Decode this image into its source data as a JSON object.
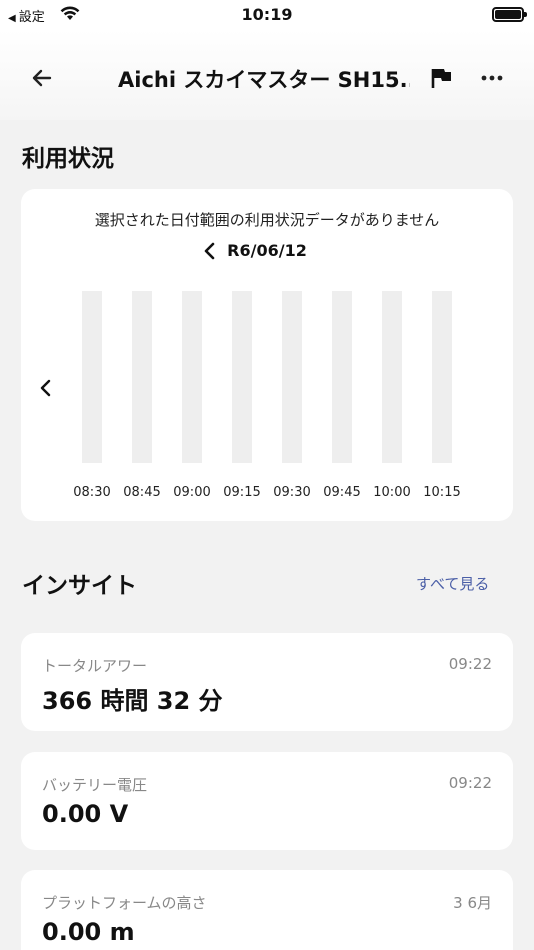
{
  "status_bar": {
    "back_label": "設定",
    "time": "10:19"
  },
  "nav": {
    "title": "Aichi スカイマスター SH15..."
  },
  "usage": {
    "section_title": "利用状況",
    "no_data_message": "選択された日付範囲の利用状況データがありません",
    "date": "R6/06/12"
  },
  "chart_data": {
    "type": "bar",
    "categories": [
      "08:30",
      "08:45",
      "09:00",
      "09:15",
      "09:30",
      "09:45",
      "10:00",
      "10:15"
    ],
    "values": [
      null,
      null,
      null,
      null,
      null,
      null,
      null,
      null
    ],
    "title": "",
    "xlabel": "",
    "ylabel": ""
  },
  "insights": {
    "section_title": "インサイト",
    "see_all_label": "すべて見る",
    "items": [
      {
        "label": "トータルアワー",
        "time": "09:22",
        "value": "366 時間 32 分"
      },
      {
        "label": "バッテリー電圧",
        "time": "09:22",
        "value": "0.00 V"
      },
      {
        "label": "プラットフォームの高さ",
        "time": "3 6月",
        "value": "0.00 m"
      }
    ]
  }
}
